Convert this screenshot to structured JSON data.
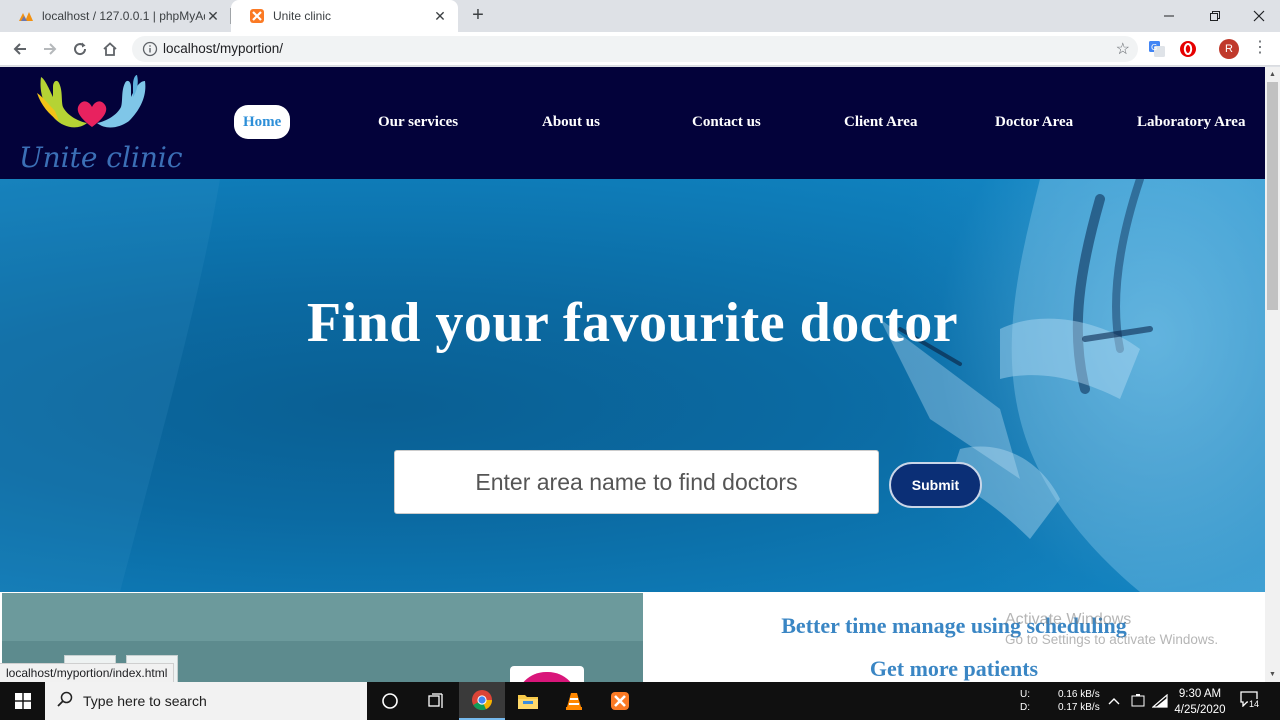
{
  "browser": {
    "tabs": [
      {
        "title": "localhost / 127.0.0.1 | phpMyAdmin",
        "active": false
      },
      {
        "title": "Unite clinic",
        "active": true
      }
    ],
    "new_tab_label": "+",
    "url": "localhost/myportion/",
    "status_url": "localhost/myportion/index.html",
    "profile_initial": "R"
  },
  "site": {
    "logo_text": "Unite clinic",
    "nav": [
      {
        "label": "Home",
        "active": true
      },
      {
        "label": "Our services",
        "active": false
      },
      {
        "label": "About us",
        "active": false
      },
      {
        "label": "Contact us",
        "active": false
      },
      {
        "label": "Client Area",
        "active": false
      },
      {
        "label": "Doctor Area",
        "active": false
      },
      {
        "label": "Laboratory Area",
        "active": false
      }
    ],
    "hero": {
      "title": "Find your favourite doctor",
      "search_placeholder": "Enter area name to find doctors",
      "submit_label": "Submit"
    },
    "features": [
      "Better time manage using scheduling",
      "Get more patients"
    ]
  },
  "watermark": {
    "line1": "Activate Windows",
    "line2": "Go to Settings to activate Windows."
  },
  "taskbar": {
    "search_placeholder": "Type here to search",
    "net_labels": [
      "U:",
      "D:"
    ],
    "net_up": "0.16 kB/s",
    "net_down": "0.17 kB/s",
    "time": "9:30 AM",
    "date": "4/25/2020",
    "notification_count": "14"
  },
  "colors": {
    "nav_bg": "#03023a",
    "hero_blue": "#0b6aa2",
    "submit_bg": "#0b2f76",
    "feature_text": "#3a86c4"
  }
}
